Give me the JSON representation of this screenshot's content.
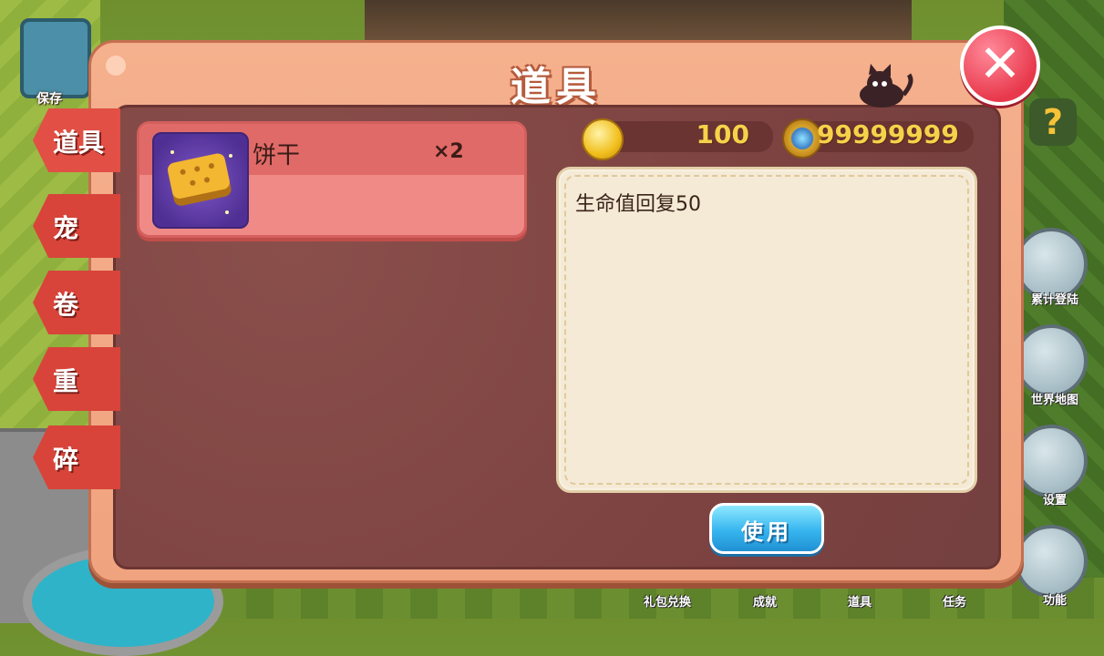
{
  "modal": {
    "title": "道具"
  },
  "side_tabs": [
    {
      "label": "道具",
      "active": true
    },
    {
      "label": "宠",
      "active": false
    },
    {
      "label": "卷",
      "active": false
    },
    {
      "label": "重",
      "active": false
    },
    {
      "label": "碎",
      "active": false
    }
  ],
  "items": [
    {
      "name": "饼干",
      "count": "×2",
      "icon": "biscuit-icon",
      "selected": true
    }
  ],
  "currency": {
    "coins": "100",
    "gems": "99999999"
  },
  "description": "生命值回复50",
  "use_button_label": "使用",
  "background": {
    "top_left_label": "保存",
    "right_labels": [
      "累计登陆",
      "世界地图",
      "设置",
      "功能"
    ],
    "bottom_labels": [
      "礼包兑换",
      "成就",
      "道具",
      "任务"
    ],
    "help_symbol": "?"
  },
  "colors": {
    "panel_frame": "#f0a37f",
    "panel_inner": "#7d4341",
    "accent_red": "#e24f45",
    "gold_text": "#f6d24a",
    "use_button": "#36b5ef"
  }
}
